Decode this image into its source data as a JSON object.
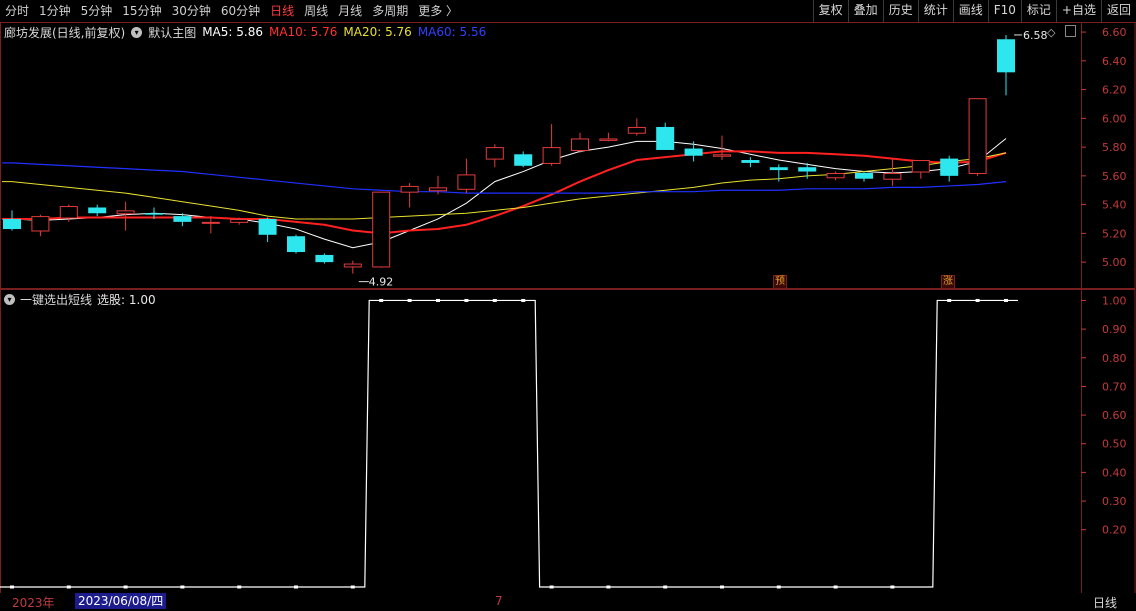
{
  "toolbar": {
    "periods": [
      "分时",
      "1分钟",
      "5分钟",
      "15分钟",
      "30分钟",
      "60分钟",
      "日线",
      "周线",
      "月线",
      "多周期",
      "更多 〉"
    ],
    "active_period": "日线",
    "tools": [
      "复权",
      "叠加",
      "历史",
      "统计",
      "画线",
      "F10",
      "标记",
      "+自选",
      "返回"
    ]
  },
  "main_chart": {
    "stock_title": "廊坊发展(日线,前复权)",
    "indicator_name": "默认主图",
    "ma5": "MA5: 5.86",
    "ma10": "MA10: 5.76",
    "ma20": "MA20: 5.76",
    "ma60": "MA60: 5.56",
    "high_label": "6.58",
    "low_label": "4.92",
    "marker1": "预",
    "marker2": "涨"
  },
  "sub_chart": {
    "indicator_name": "一键选出短线",
    "value_label": "选股: 1.00"
  },
  "footer": {
    "year": "2023年",
    "date": "2023/06/08/四",
    "month": "7",
    "period": "日线"
  },
  "colors": {
    "up": "#e23b3b",
    "down": "#2ee6ee",
    "ma5": "#ffffff",
    "ma10": "#ff2020",
    "ma20": "#e8e030",
    "ma60": "#2030ff",
    "axis": "#c23b3b"
  },
  "chart_data": [
    {
      "type": "candlestick",
      "title": "廊坊发展(日线,前复权)",
      "y_ticks": [
        5.0,
        5.2,
        5.4,
        5.6,
        5.8,
        6.0,
        6.2,
        6.4,
        6.6
      ],
      "ylim": [
        4.82,
        6.67
      ],
      "candles": [
        [
          5.3,
          5.36,
          5.22,
          5.23
        ],
        [
          5.22,
          5.33,
          5.18,
          5.32
        ],
        [
          5.31,
          5.4,
          5.28,
          5.39
        ],
        [
          5.38,
          5.4,
          5.32,
          5.34
        ],
        [
          5.34,
          5.42,
          5.22,
          5.36
        ],
        [
          5.34,
          5.38,
          5.3,
          5.33
        ],
        [
          5.32,
          5.34,
          5.25,
          5.28
        ],
        [
          5.28,
          5.32,
          5.2,
          5.28
        ],
        [
          5.28,
          5.31,
          5.26,
          5.3
        ],
        [
          5.3,
          5.31,
          5.14,
          5.19
        ],
        [
          5.18,
          5.19,
          5.06,
          5.07
        ],
        [
          5.05,
          5.06,
          4.99,
          5.0
        ],
        [
          4.97,
          5.01,
          4.92,
          4.99
        ],
        [
          4.97,
          5.49,
          4.96,
          5.49
        ],
        [
          5.49,
          5.55,
          5.38,
          5.53
        ],
        [
          5.5,
          5.6,
          5.47,
          5.52
        ],
        [
          5.51,
          5.72,
          5.48,
          5.61
        ],
        [
          5.72,
          5.82,
          5.66,
          5.8
        ],
        [
          5.75,
          5.77,
          5.66,
          5.67
        ],
        [
          5.69,
          5.96,
          5.67,
          5.8
        ],
        [
          5.78,
          5.9,
          5.76,
          5.86
        ],
        [
          5.85,
          5.9,
          5.84,
          5.86
        ],
        [
          5.9,
          6.0,
          5.88,
          5.94
        ],
        [
          5.94,
          5.97,
          5.78,
          5.78
        ],
        [
          5.79,
          5.84,
          5.7,
          5.74
        ],
        [
          5.74,
          5.88,
          5.71,
          5.75
        ],
        [
          5.71,
          5.73,
          5.66,
          5.69
        ],
        [
          5.66,
          5.68,
          5.56,
          5.64
        ],
        [
          5.66,
          5.69,
          5.58,
          5.63
        ],
        [
          5.59,
          5.63,
          5.57,
          5.62
        ],
        [
          5.62,
          5.63,
          5.56,
          5.58
        ],
        [
          5.58,
          5.72,
          5.53,
          5.62
        ],
        [
          5.63,
          5.71,
          5.58,
          5.71
        ],
        [
          5.72,
          5.74,
          5.56,
          5.6
        ],
        [
          5.62,
          6.14,
          5.6,
          6.14
        ],
        [
          6.55,
          6.58,
          6.16,
          6.32
        ]
      ],
      "series": [
        {
          "name": "MA5",
          "values": [
            5.3,
            5.29,
            5.3,
            5.31,
            5.33,
            5.34,
            5.33,
            5.31,
            5.3,
            5.27,
            5.23,
            5.16,
            5.1,
            5.14,
            5.22,
            5.3,
            5.41,
            5.56,
            5.63,
            5.71,
            5.77,
            5.8,
            5.84,
            5.84,
            5.82,
            5.79,
            5.75,
            5.71,
            5.68,
            5.65,
            5.63,
            5.62,
            5.63,
            5.65,
            5.7,
            5.86
          ]
        },
        {
          "name": "MA10",
          "values": [
            5.3,
            5.3,
            5.31,
            5.31,
            5.31,
            5.31,
            5.31,
            5.31,
            5.3,
            5.3,
            5.28,
            5.26,
            5.22,
            5.2,
            5.22,
            5.23,
            5.26,
            5.32,
            5.39,
            5.47,
            5.56,
            5.64,
            5.71,
            5.73,
            5.75,
            5.77,
            5.77,
            5.76,
            5.76,
            5.75,
            5.74,
            5.72,
            5.7,
            5.69,
            5.7,
            5.76
          ]
        },
        {
          "name": "MA20",
          "values": [
            5.56,
            5.54,
            5.52,
            5.5,
            5.48,
            5.45,
            5.42,
            5.39,
            5.36,
            5.32,
            5.3,
            5.3,
            5.3,
            5.31,
            5.32,
            5.33,
            5.34,
            5.36,
            5.38,
            5.41,
            5.44,
            5.46,
            5.48,
            5.5,
            5.52,
            5.55,
            5.57,
            5.58,
            5.6,
            5.61,
            5.63,
            5.65,
            5.67,
            5.7,
            5.72,
            5.76
          ]
        },
        {
          "name": "MA60",
          "values": [
            5.69,
            5.68,
            5.67,
            5.66,
            5.65,
            5.64,
            5.63,
            5.61,
            5.59,
            5.57,
            5.55,
            5.53,
            5.51,
            5.5,
            5.49,
            5.49,
            5.48,
            5.48,
            5.48,
            5.48,
            5.48,
            5.48,
            5.49,
            5.49,
            5.49,
            5.5,
            5.5,
            5.5,
            5.51,
            5.51,
            5.51,
            5.52,
            5.52,
            5.53,
            5.54,
            5.56
          ]
        }
      ]
    },
    {
      "type": "line",
      "title": "一键选出短线",
      "y_ticks": [
        0.2,
        0.3,
        0.4,
        0.5,
        0.6,
        0.7,
        0.8,
        0.9,
        1.0
      ],
      "ylim": [
        0,
        1.04
      ],
      "series": [
        {
          "name": "选股",
          "values": [
            0,
            0,
            0,
            0,
            0,
            0,
            0,
            0,
            0,
            0,
            0,
            0,
            0,
            1,
            1,
            1,
            1,
            1,
            1,
            0,
            0,
            0,
            0,
            0,
            0,
            0,
            0,
            0,
            0,
            0,
            0,
            0,
            0,
            1,
            1,
            1
          ]
        }
      ],
      "x_index_map": [
        0,
        2,
        4,
        6,
        8,
        10,
        12,
        13,
        14,
        15,
        16,
        17,
        18,
        19,
        21,
        23,
        25,
        27,
        29,
        31,
        33,
        34,
        35
      ]
    }
  ]
}
